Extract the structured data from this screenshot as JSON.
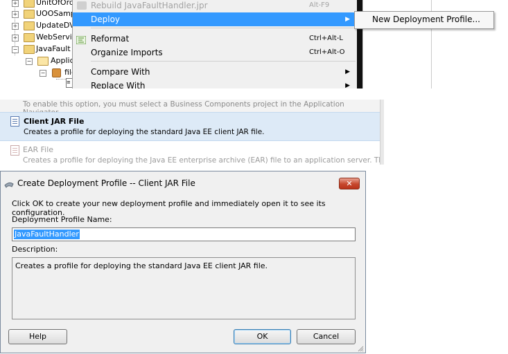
{
  "navigator": {
    "items": [
      {
        "label": "UnitOfOrde"
      },
      {
        "label": "UOOSampl"
      },
      {
        "label": "UpdateDVM"
      },
      {
        "label": "WebServic"
      },
      {
        "label": "JavaFault"
      },
      {
        "label": "Applica"
      },
      {
        "label": "file"
      }
    ]
  },
  "context_menu": {
    "rebuild": {
      "label": "Rebuild JavaFaultHandler.jpr",
      "shortcut": "Alt-F9"
    },
    "deploy": {
      "label": "Deploy"
    },
    "reformat": {
      "label": "Reformat",
      "shortcut": "Ctrl+Alt-L"
    },
    "organize_imports": {
      "label": "Organize Imports",
      "shortcut": "Ctrl+Alt-O"
    },
    "compare_with": {
      "label": "Compare With"
    },
    "replace_with": {
      "label": "Replace With"
    }
  },
  "submenu": {
    "new_deployment_profile": "New Deployment Profile..."
  },
  "profile_list": {
    "top_note": "To enable this option, you must select a Business Components project in the Application Navigator.",
    "items": [
      {
        "title": "Client JAR File",
        "description": "Creates a profile for deploying the standard Java EE client JAR file.",
        "selected": true
      },
      {
        "title": "EAR File",
        "description": "Creates a profile for deploying the Java EE enterprise archive (EAR) file to an application server.  The",
        "disabled": true
      }
    ]
  },
  "dialog": {
    "title": "Create Deployment Profile -- Client JAR File",
    "close_glyph": "✕",
    "intro": "Click OK to create your new deployment profile and immediately open it to see its configuration.",
    "name_label": "Deployment Profile Name:",
    "name_value": "JavaFaultHandler",
    "description_label": "Description:",
    "description_value": "Creates a profile for deploying the standard Java EE client JAR file.",
    "buttons": {
      "help": "Help",
      "ok": "OK",
      "cancel": "Cancel"
    }
  },
  "colors": {
    "menu_highlight": "#3399ff",
    "selection_bg": "#ddeaf7",
    "close_button": "#c7472d"
  }
}
